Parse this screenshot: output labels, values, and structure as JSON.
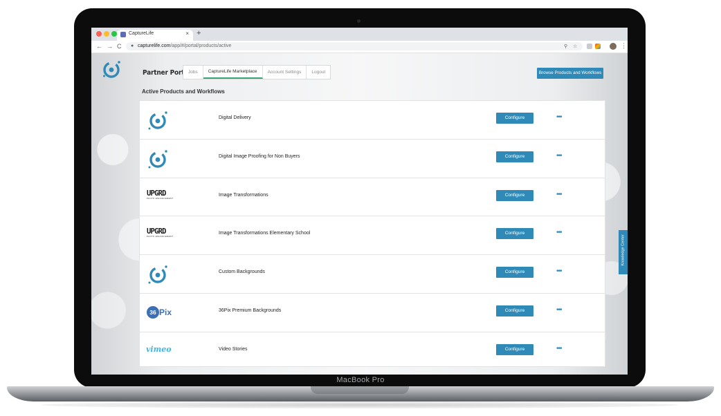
{
  "device": {
    "label": "MacBook Pro"
  },
  "browser": {
    "tab_title": "CaptureLife",
    "tab_close": "×",
    "new_tab": "+",
    "url_host": "capturelife.com",
    "url_path": "/app/#/portal/products/active",
    "back": "←",
    "forward": "→",
    "reload": "C"
  },
  "header": {
    "portal_title": "Partner Portal",
    "tabs": [
      {
        "label": "Jobs"
      },
      {
        "label": "CaptureLife Marketplace"
      },
      {
        "label": "Account Settings"
      },
      {
        "label": "Logout"
      }
    ],
    "active_tab": "CaptureLife Marketplace",
    "browse_button": "Browse Products and Workflows"
  },
  "main": {
    "heading": "Active Products and Workflows",
    "configure_label": "Configure",
    "more_label": "•••",
    "products": [
      {
        "name": "Digital Delivery",
        "logo": "capturelife-logo"
      },
      {
        "name": "Digital Image Proofing for Non Buyers",
        "logo": "capturelife-logo"
      },
      {
        "name": "Image Transformations",
        "logo": "upgrd-logo"
      },
      {
        "name": "Image Transformations Elementary School",
        "logo": "upgrd-logo"
      },
      {
        "name": "Custom Backgrounds",
        "logo": "capturelife-logo"
      },
      {
        "name": "36Pix Premium Backgrounds",
        "logo": "36pix-logo"
      },
      {
        "name": "Video Stories",
        "logo": "vimeo-logo"
      }
    ]
  },
  "logos": {
    "upgrd": {
      "title": "UPGRD",
      "subtitle": "PHOTO ENHANCEMENT"
    },
    "pix": {
      "num": "36",
      "word": "Pix"
    },
    "vimeo": "vimeo"
  },
  "side_tab": {
    "label": "Knowledge Center"
  },
  "colors": {
    "accent": "#2f8ab8",
    "active_underline": "#3aa57b",
    "brand": "#2f8ab8"
  }
}
